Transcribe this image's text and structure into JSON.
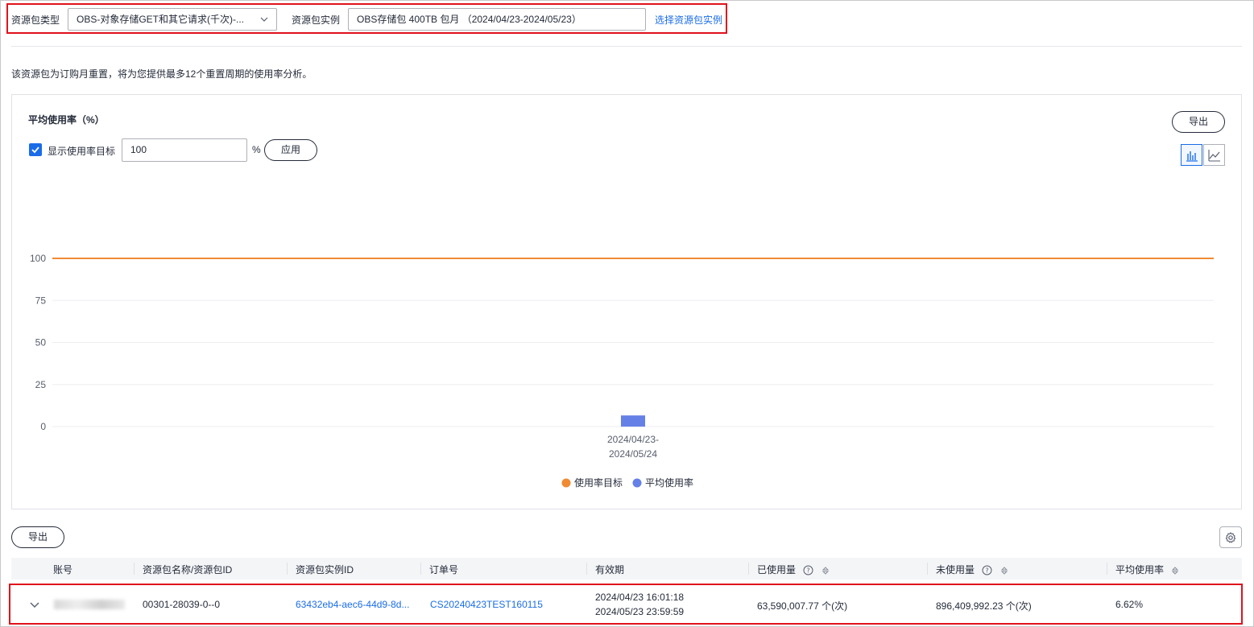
{
  "filters": {
    "type_label": "资源包类型",
    "type_value": "OBS-对象存储GET和其它请求(千次)-...",
    "instance_label": "资源包实例",
    "instance_value": "OBS存储包 400TB 包月 （2024/04/23-2024/05/23）",
    "select_instance_link": "选择资源包实例"
  },
  "description": "该资源包为订购月重置，将为您提供最多12个重置周期的使用率分析。",
  "panel": {
    "title": "平均使用率（%）",
    "show_target_label": "显示使用率目标",
    "target_value": "100",
    "percent_sign": "%",
    "apply_label": "应用",
    "export_label": "导出"
  },
  "chart_data": {
    "type": "bar",
    "categories": [
      "2024/04/23-2024/05/24"
    ],
    "category_lines": [
      [
        "2024/04/23-",
        "2024/05/24"
      ]
    ],
    "series": [
      {
        "name": "平均使用率",
        "type": "bar",
        "values": [
          6.62
        ],
        "color": "#6580e6"
      },
      {
        "name": "使用率目标",
        "type": "line",
        "values": [
          100
        ],
        "color": "#f08a33"
      }
    ],
    "yticks": [
      "100",
      "75",
      "50",
      "25",
      "0"
    ],
    "ylim": [
      0,
      100
    ],
    "grid": true,
    "legend_position": "bottom-center"
  },
  "table": {
    "export_label": "导出",
    "columns": [
      "账号",
      "资源包名称/资源包ID",
      "资源包实例ID",
      "订单号",
      "有效期",
      "已使用量",
      "未使用量",
      "平均使用率"
    ],
    "row": {
      "package_id": "00301-28039-0--0",
      "instance_id": "63432eb4-aec6-44d9-8d...",
      "order_no": "CS20240423TEST160115",
      "validity_start": "2024/04/23 16:01:18",
      "validity_end": "2024/05/23 23:59:59",
      "used": "63,590,007.77 个(次)",
      "unused": "896,409,992.23 个(次)",
      "avg_rate": "6.62%"
    }
  },
  "colors": {
    "accent": "#1a6ce8",
    "highlight": "#e0121c",
    "target_line": "#f08a33",
    "bar": "#6580e6"
  }
}
